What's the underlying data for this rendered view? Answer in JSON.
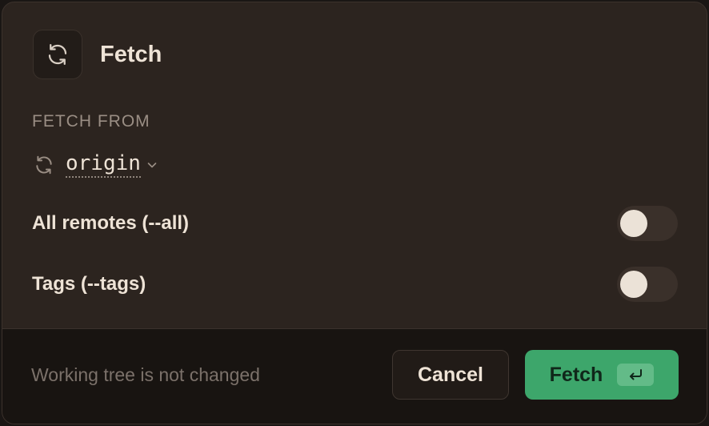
{
  "dialog": {
    "title": "Fetch",
    "title_icon": "refresh-icon"
  },
  "fetch_from": {
    "label": "FETCH FROM",
    "remote_icon": "refresh-icon",
    "remote": "origin"
  },
  "options": {
    "all_remotes": {
      "label": "All remotes (--all)",
      "enabled": false
    },
    "tags": {
      "label": "Tags (--tags)",
      "enabled": false
    }
  },
  "footer": {
    "status": "Working tree is not changed",
    "cancel_label": "Cancel",
    "fetch_label": "Fetch",
    "fetch_shortcut_icon": "enter-key-icon"
  },
  "colors": {
    "accent": "#3da66b",
    "dialog_bg": "#2c241f",
    "footer_bg": "#181411"
  }
}
